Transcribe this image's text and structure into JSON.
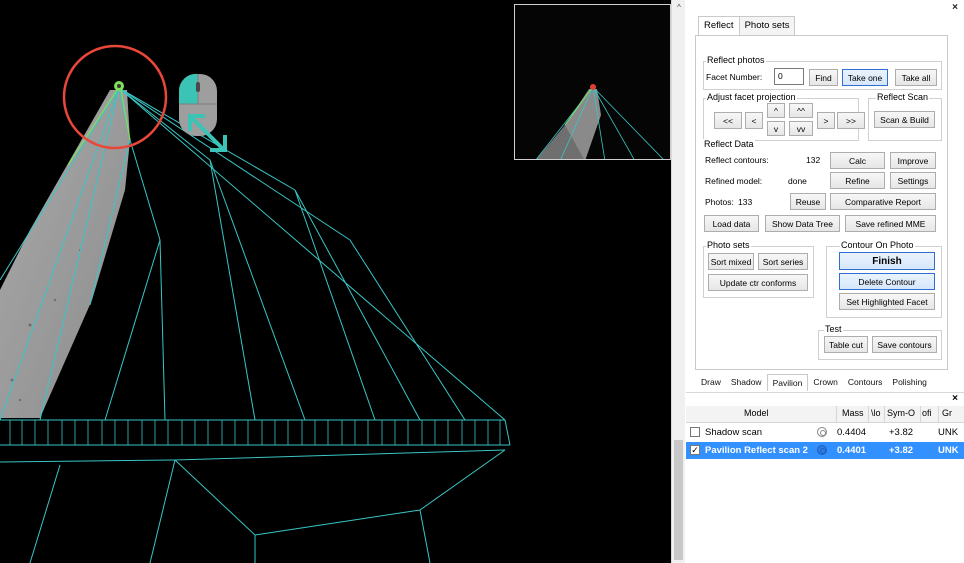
{
  "colors": {
    "wireframe": "#39c6c6",
    "highlight_circle": "#e8473a",
    "selection": "#3390ff"
  },
  "main_tabs": [
    {
      "label": "Reflect"
    },
    {
      "label": "Photo sets"
    }
  ],
  "reflect_photos": {
    "title": "Reflect photos",
    "facet_label": "Facet Number:",
    "facet_value": "0",
    "find": "Find",
    "take_one": "Take one",
    "take_all": "Take all"
  },
  "adjust": {
    "title": "Adjust facet projection",
    "btn_ll": "<<",
    "btn_l": "<",
    "btn_up": "^",
    "btn_upup": "^^",
    "btn_down": "v",
    "btn_downdown": "vv",
    "btn_r": ">",
    "btn_rr": ">>"
  },
  "reflect_scan": {
    "title": "Reflect Scan",
    "scan_build": "Scan & Build"
  },
  "reflect_data": {
    "title": "Reflect Data",
    "contours_label": "Reflect contours:",
    "contours_value": "132",
    "calc": "Calc",
    "improve": "Improve",
    "refined_label": "Refined model:",
    "refined_value": "done",
    "refine": "Refine",
    "settings": "Settings",
    "photos_label": "Photos:",
    "photos_value": "133",
    "reuse": "Reuse",
    "comparative": "Comparative Report",
    "load": "Load data",
    "show_tree": "Show Data Tree",
    "save_refined": "Save refined MME"
  },
  "photo_sets": {
    "title": "Photo sets",
    "sort_mixed": "Sort mixed",
    "sort_series": "Sort series",
    "update": "Update ctr conforms"
  },
  "contour_on_photo": {
    "title": "Contour On Photo",
    "finish": "Finish",
    "delete": "Delete Contour",
    "set_highlighted": "Set Highlighted Facet"
  },
  "test": {
    "title": "Test",
    "table_cut": "Table cut",
    "save_contours": "Save contours"
  },
  "bottom_tabs": [
    {
      "label": "Draw"
    },
    {
      "label": "Shadow"
    },
    {
      "label": "Pavilion"
    },
    {
      "label": "Crown"
    },
    {
      "label": "Contours"
    },
    {
      "label": "Polishing"
    }
  ],
  "grid": {
    "headers": [
      "Model",
      "Mass",
      "\\lo",
      "Sym-O",
      "ofi",
      "Gr"
    ],
    "rows": [
      {
        "checked": false,
        "model": "Shadow scan",
        "mass": "0.4404",
        "sym": "+3.82",
        "gr": "UNK"
      },
      {
        "checked": true,
        "model": "Pavilion Reflect scan 2",
        "mass": "0.4401",
        "sym": "+3.82",
        "gr": "UNK"
      }
    ]
  },
  "icons": {
    "close": "close-icon",
    "mouse": "mouse-scroll-icon",
    "resize": "diagonal-arrow-icon",
    "scroll_up": "chevron-up-icon"
  }
}
